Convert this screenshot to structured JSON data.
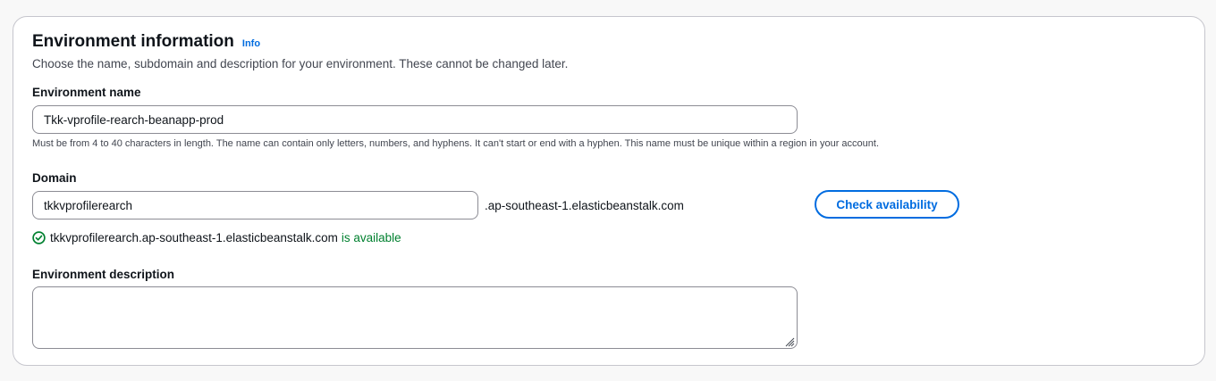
{
  "section": {
    "title": "Environment information",
    "info_label": "Info",
    "description": "Choose the name, subdomain and description for your environment. These cannot be changed later."
  },
  "environment_name": {
    "label": "Environment name",
    "value": "Tkk-vprofile-rearch-beanapp-prod",
    "hint": "Must be from 4 to 40 characters in length. The name can contain only letters, numbers, and hyphens. It can't start or end with a hyphen. This name must be unique within a region in your account."
  },
  "domain": {
    "label": "Domain",
    "value": "tkkvprofilerearch",
    "suffix": ".ap-southeast-1.elasticbeanstalk.com",
    "check_button_label": "Check availability",
    "availability_domain": "tkkvprofilerearch.ap-southeast-1.elasticbeanstalk.com",
    "availability_status": "is available",
    "status_color": "#00802f"
  },
  "environment_description": {
    "label": "Environment description",
    "value": ""
  },
  "colors": {
    "accent": "#006ce0",
    "success": "#00802f",
    "border": "#8c8c94"
  },
  "icons": {
    "status": "check-circle-icon",
    "grip": "resize-grip-icon"
  }
}
